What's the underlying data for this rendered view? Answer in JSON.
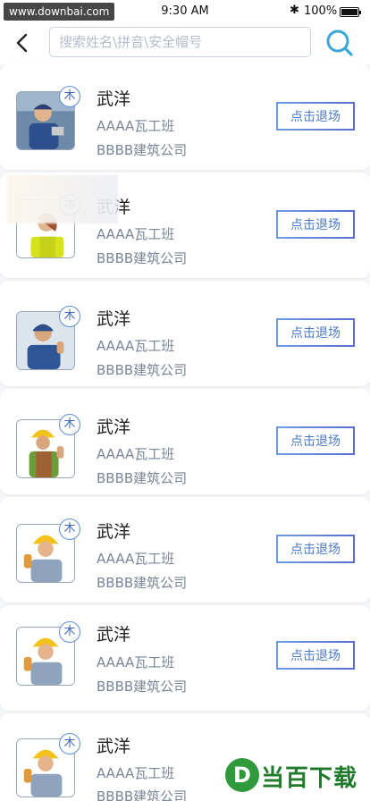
{
  "status_bar": {
    "watermark": "www.downbai.com",
    "time": "9:30 AM",
    "bluetooth": "✱",
    "battery_pct": "100%"
  },
  "header": {
    "back_icon": "back-chevron-icon",
    "search_placeholder": "搜索姓名\\拼音\\安全帽号",
    "search_icon": "search-icon",
    "accent_color": "#3aa7d8"
  },
  "workers": [
    {
      "name": "武洋",
      "badge": "木",
      "team": "AAAA瓦工班",
      "company": "BBBB建筑公司",
      "action": "点击退场"
    },
    {
      "name": "武洋",
      "badge": "木",
      "team": "AAAA瓦工班",
      "company": "BBBB建筑公司",
      "action": "点击退场"
    },
    {
      "name": "武洋",
      "badge": "木",
      "team": "AAAA瓦工班",
      "company": "BBBB建筑公司",
      "action": "点击退场"
    },
    {
      "name": "武洋",
      "badge": "木",
      "team": "AAAA瓦工班",
      "company": "BBBB建筑公司",
      "action": "点击退场"
    },
    {
      "name": "武洋",
      "badge": "木",
      "team": "AAAA瓦工班",
      "company": "BBBB建筑公司",
      "action": "点击退场"
    },
    {
      "name": "武洋",
      "badge": "木",
      "team": "AAAA瓦工班",
      "company": "BBBB建筑公司",
      "action": "点击退场"
    },
    {
      "name": "武洋",
      "badge": "木",
      "team": "AAAA瓦工班",
      "company": "BBBB建筑公司",
      "action": "点击退场"
    }
  ],
  "brand": {
    "logo_letter": "D",
    "text": "当百下载"
  }
}
